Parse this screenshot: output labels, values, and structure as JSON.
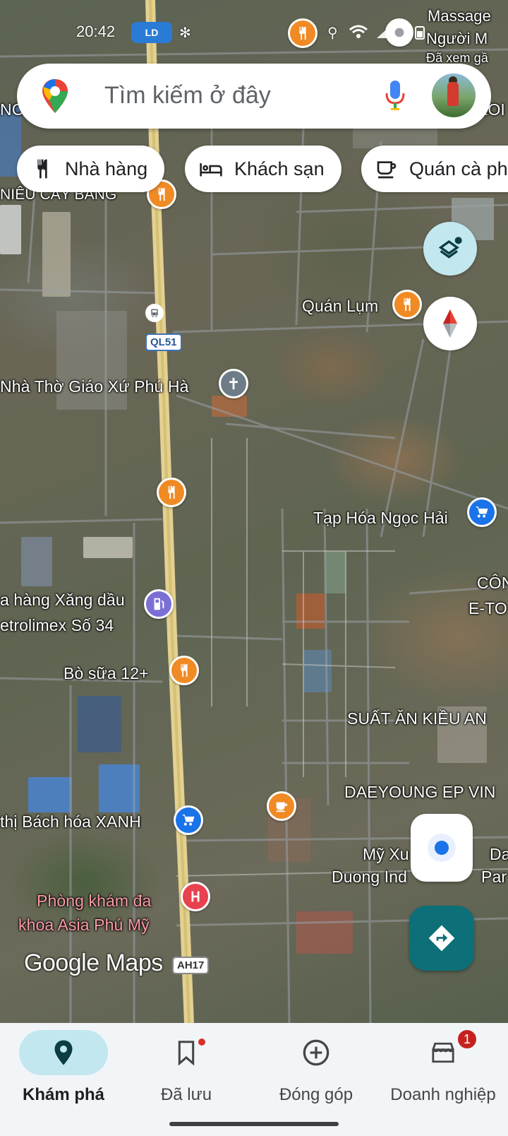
{
  "status_bar": {
    "time": "20:42",
    "notification_text": "LD"
  },
  "search": {
    "placeholder": "Tìm kiếm ở đây"
  },
  "chips": [
    {
      "label": "Nhà hàng",
      "icon": "restaurant-icon"
    },
    {
      "label": "Khách sạn",
      "icon": "hotel-icon"
    },
    {
      "label": "Quán cà phê",
      "icon": "coffee-icon"
    }
  ],
  "map": {
    "labels": {
      "massage": "Massage",
      "nguoi": "Người M",
      "da_xem": "Đã xem gầ",
      "top_left_partial": "NC",
      "top_right_partial": "KOI",
      "nieu": "NIÊU CÂY BÀNG",
      "quan_lum": "Quán Lụm",
      "nha_tho": "Nhà Thờ Giáo Xứ Phú Hà",
      "tap_hoa": "Tạp Hóa Ngọc Hải",
      "cong": "CÔN",
      "eto": "E-TO",
      "xang_dau_1": "a hàng Xăng dầu",
      "xang_dau_2": "etrolimex Số 34",
      "bo_sua": "Bò sữa 12+",
      "suat_an": "SUẤT ĂN KIỀU AN",
      "daeyoung": "DAEYOUNG EP VIN",
      "bach_hoa": "thị Bách hóa XANH",
      "my_xuan_1": "Mỹ Xu",
      "my_xuan_2": "Da",
      "duong_ind": "Duong Ind",
      "par": "Par",
      "phong_kham_1": "Phòng khám đa",
      "phong_kham_2": "khoa Asia Phú Mỹ"
    },
    "road_shields": {
      "ql51": "QL51",
      "ah17": "AH17"
    },
    "logo_text": "Google Maps"
  },
  "bottom_nav": [
    {
      "label": "Khám phá",
      "icon": "explore-pin-icon",
      "active": true
    },
    {
      "label": "Đã lưu",
      "icon": "bookmark-icon",
      "active": false
    },
    {
      "label": "Đóng góp",
      "icon": "add-circle-icon",
      "active": false
    },
    {
      "label": "Doanh nghiệp",
      "icon": "storefront-icon",
      "active": false,
      "badge": "1"
    }
  ],
  "colors": {
    "accent_teal": "#0d7078",
    "active_pill": "#c2e7ef",
    "poi_orange": "#f08a24",
    "poi_blue": "#1a73e8"
  }
}
